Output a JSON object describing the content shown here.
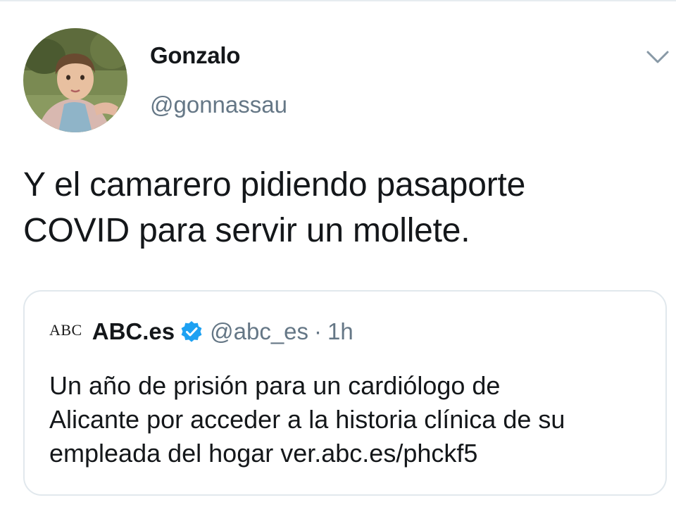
{
  "tweet": {
    "author_name": "Gonzalo",
    "author_handle": "@gonnassau",
    "text_line1": "Y el camarero pidiendo pasaporte",
    "text_line2": "COVID para servir un mollete."
  },
  "quoted_tweet": {
    "logo_text": "ABC",
    "author_name": "ABC.es",
    "author_handle": "@abc_es",
    "separator": "·",
    "time": "1h",
    "text_line1": "Un año de prisión para un cardiólogo de",
    "text_line2": "Alicante por acceder a la historia clínica de su",
    "text_line3": "empleada del hogar ver.abc.es/phckf5"
  },
  "icons": {
    "menu": "chevron-down-icon",
    "verified": "verified-badge-icon"
  },
  "colors": {
    "text": "#14171a",
    "secondary_text": "#657786",
    "verified_blue": "#1da1f2",
    "border": "#e1e8ed"
  }
}
